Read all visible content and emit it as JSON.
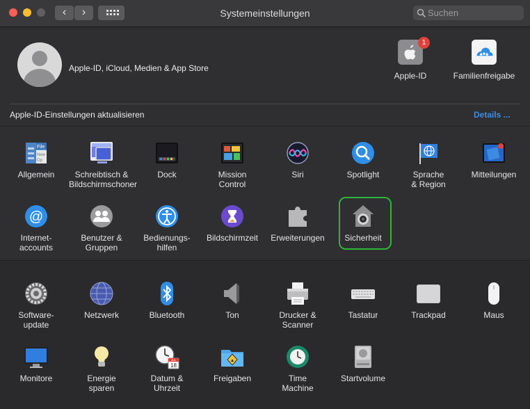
{
  "window": {
    "title": "Systemeinstellungen"
  },
  "search": {
    "placeholder": "Suchen"
  },
  "account": {
    "summary": "Apple-ID, iCloud, Medien & App Store"
  },
  "top_items": [
    {
      "label": "Apple-ID",
      "badge": "1",
      "icon": "apple-id-icon"
    },
    {
      "label": "Familienfreigabe",
      "icon": "family-sharing-icon"
    }
  ],
  "update_banner": {
    "text": "Apple-ID-Einstellungen aktualisieren",
    "link": "Details ..."
  },
  "panes_row1": [
    {
      "label": "Allgemein",
      "icon": "general-icon"
    },
    {
      "label": "Schreibtisch &\nBildschirmschoner",
      "icon": "desktop-screensaver-icon"
    },
    {
      "label": "Dock",
      "icon": "dock-icon"
    },
    {
      "label": "Mission\nControl",
      "icon": "mission-control-icon"
    },
    {
      "label": "Siri",
      "icon": "siri-icon"
    },
    {
      "label": "Spotlight",
      "icon": "spotlight-icon"
    },
    {
      "label": "Sprache\n& Region",
      "icon": "language-region-icon"
    },
    {
      "label": "Mitteilungen",
      "icon": "notifications-icon"
    }
  ],
  "panes_row2": [
    {
      "label": "Internet-\naccounts",
      "icon": "internet-accounts-icon"
    },
    {
      "label": "Benutzer &\nGruppen",
      "icon": "users-groups-icon"
    },
    {
      "label": "Bedienungs-\nhilfen",
      "icon": "accessibility-icon"
    },
    {
      "label": "Bildschirmzeit",
      "icon": "screen-time-icon"
    },
    {
      "label": "Erweiterungen",
      "icon": "extensions-icon"
    },
    {
      "label": "Sicherheit",
      "icon": "security-icon"
    }
  ],
  "panes_row3": [
    {
      "label": "Software-\nupdate",
      "icon": "software-update-icon"
    },
    {
      "label": "Netzwerk",
      "icon": "network-icon"
    },
    {
      "label": "Bluetooth",
      "icon": "bluetooth-icon"
    },
    {
      "label": "Ton",
      "icon": "sound-icon"
    },
    {
      "label": "Drucker &\nScanner",
      "icon": "printer-icon"
    },
    {
      "label": "Tastatur",
      "icon": "keyboard-icon"
    },
    {
      "label": "Trackpad",
      "icon": "trackpad-icon"
    },
    {
      "label": "Maus",
      "icon": "mouse-icon"
    }
  ],
  "panes_row4": [
    {
      "label": "Monitore",
      "icon": "displays-icon"
    },
    {
      "label": "Energie\nsparen",
      "icon": "energy-saver-icon"
    },
    {
      "label": "Datum &\nUhrzeit",
      "icon": "date-time-icon"
    },
    {
      "label": "Freigaben",
      "icon": "sharing-icon"
    },
    {
      "label": "Time\nMachine",
      "icon": "time-machine-icon"
    },
    {
      "label": "Startvolume",
      "icon": "startup-disk-icon"
    }
  ],
  "calendar_icon": {
    "month": "JUL",
    "day": "18"
  },
  "colors": {
    "accent": "#3a8ee6",
    "highlight": "#2fb53b",
    "badge": "#e0423a"
  }
}
